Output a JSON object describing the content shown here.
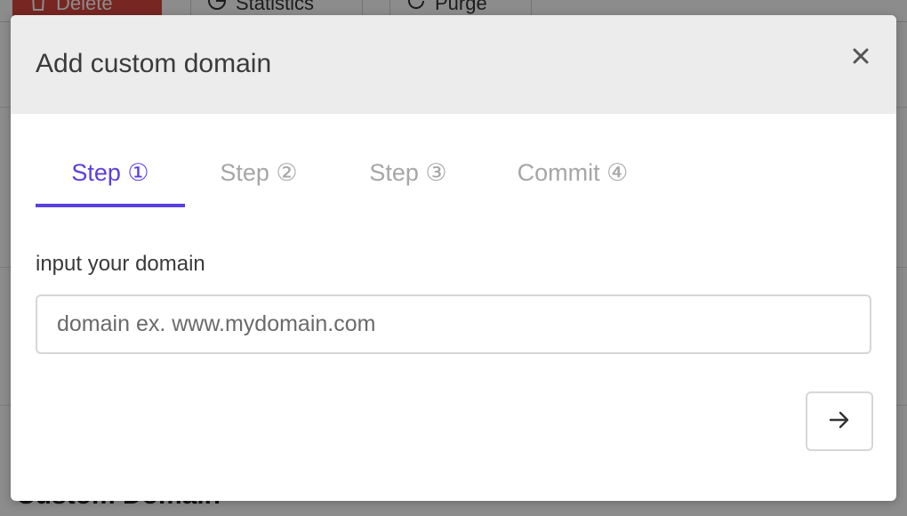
{
  "background": {
    "toolbar": {
      "delete_label": "Delete",
      "statistics_label": "Statistics",
      "purge_label": "Purge"
    },
    "section_heading": "Custom Domain"
  },
  "modal": {
    "title": "Add custom domain",
    "close_icon": "close-icon",
    "tabs": [
      {
        "label": "Step ①",
        "active": true
      },
      {
        "label": "Step ②",
        "active": false
      },
      {
        "label": "Step ③",
        "active": false
      },
      {
        "label": "Commit ④",
        "active": false
      }
    ],
    "domain_field": {
      "label": "input your domain",
      "value": "",
      "placeholder": "domain ex. www.mydomain.com"
    },
    "next_button_icon": "arrow-right-icon"
  },
  "colors": {
    "accent": "#5b3fe0",
    "inactive_tab": "#a6a6a6",
    "header_bg": "#ececec",
    "delete_red": "#d9463e"
  }
}
